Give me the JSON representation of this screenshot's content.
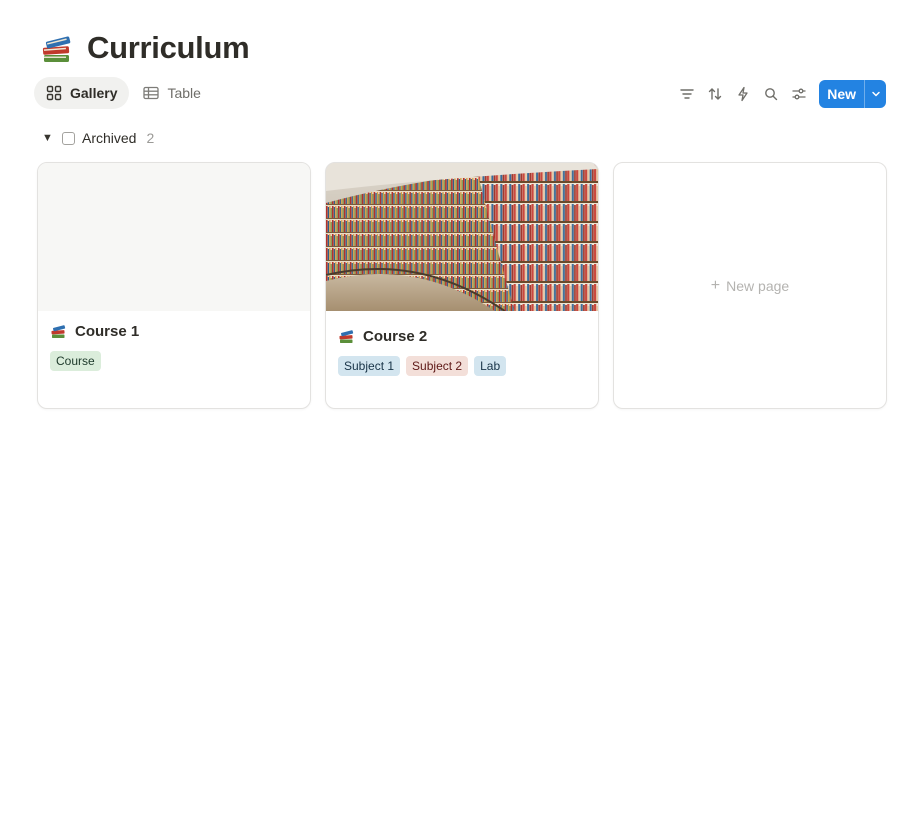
{
  "page": {
    "title": "Curriculum",
    "icon": "books-icon"
  },
  "views": [
    {
      "label": "Gallery",
      "icon": "gallery-grid-icon",
      "active": true
    },
    {
      "label": "Table",
      "icon": "table-icon",
      "active": false
    }
  ],
  "toolbar": {
    "icons": [
      "filter-icon",
      "sort-icon",
      "automation-bolt-icon",
      "search-icon",
      "settings-sliders-icon"
    ],
    "new_label": "New"
  },
  "group": {
    "label": "Archived",
    "count": "2"
  },
  "cards": [
    {
      "title": "Course 1",
      "cover": "none",
      "tags": [
        {
          "label": "Course",
          "bg": "#dbeddb",
          "fg": "#1c3829"
        }
      ]
    },
    {
      "title": "Course 2",
      "cover": "library-bookshelves-photo",
      "tags": [
        {
          "label": "Subject 1",
          "bg": "#d3e5ef",
          "fg": "#183347"
        },
        {
          "label": "Subject 2",
          "bg": "#f3dfd9",
          "fg": "#5d1715"
        },
        {
          "label": "Lab",
          "bg": "#d3e5ef",
          "fg": "#183347"
        }
      ]
    }
  ],
  "new_page_label": "New page",
  "colors": {
    "accent": "#2383e2",
    "text": "#37352f",
    "muted": "#9b9a97"
  }
}
